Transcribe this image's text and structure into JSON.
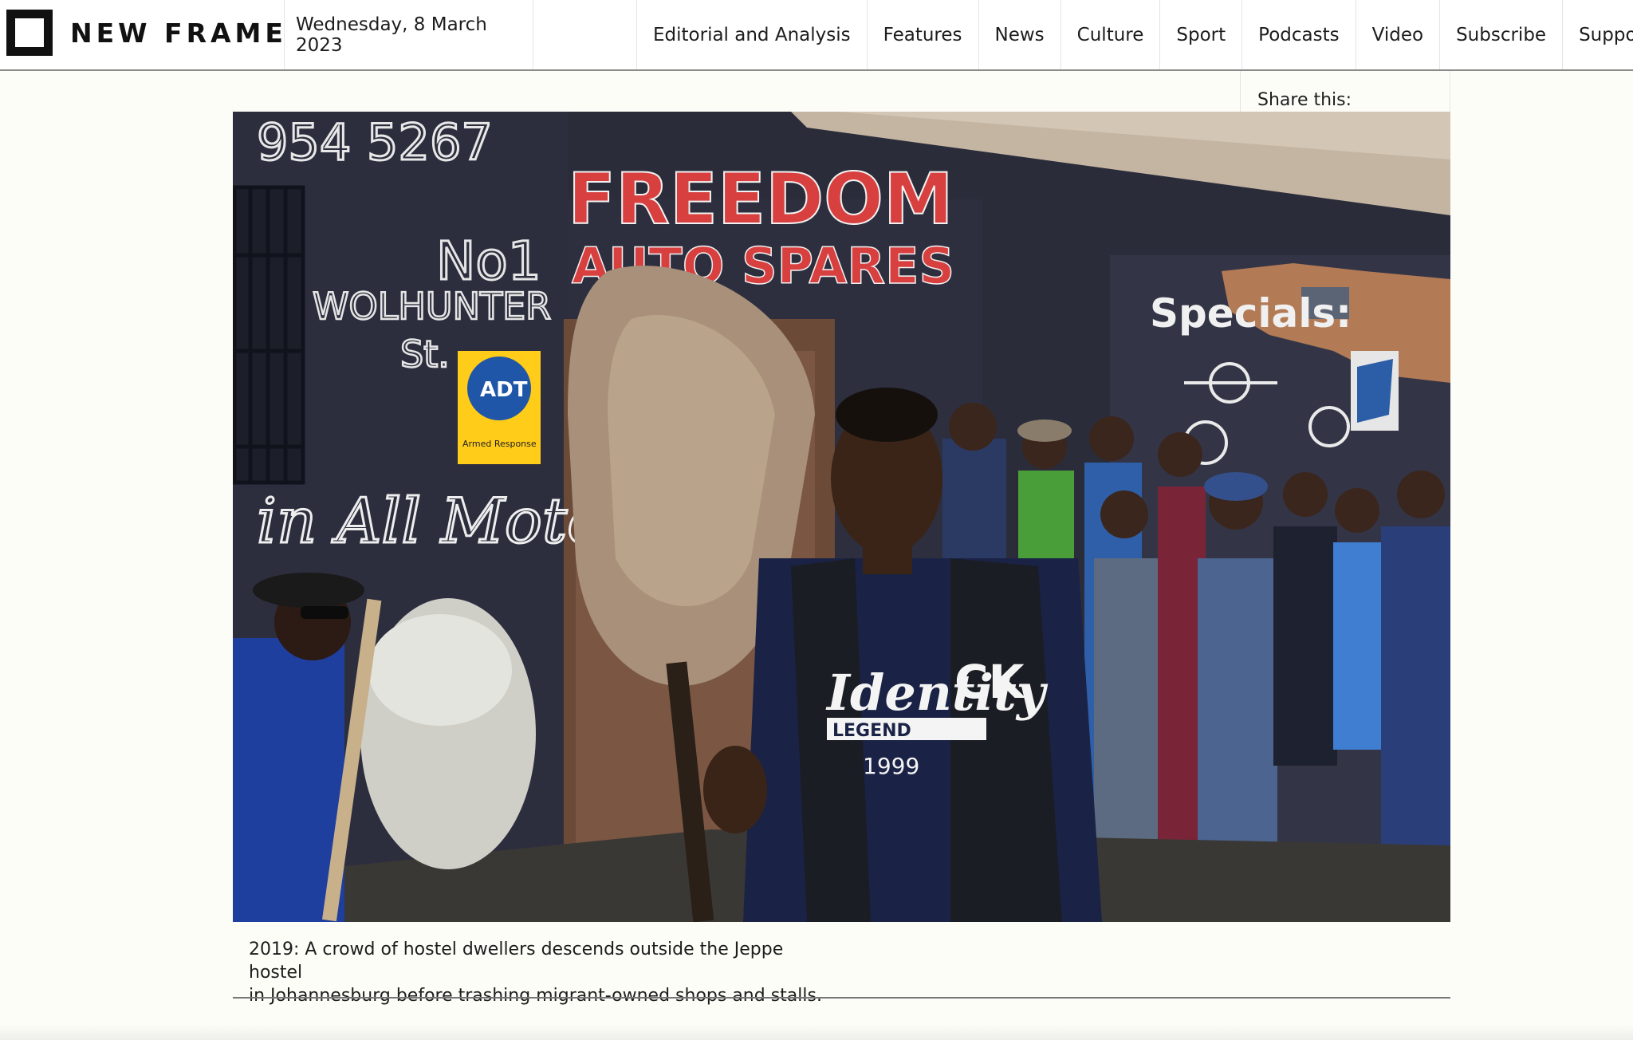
{
  "header": {
    "brand": "NEW FRAME",
    "date": "Wednesday, 8 March 2023",
    "nav": [
      "Editorial and Analysis",
      "Features",
      "News",
      "Culture",
      "Sport",
      "Podcasts",
      "Video",
      "Subscribe",
      "Support"
    ]
  },
  "share": {
    "label": "Share this:"
  },
  "photo": {
    "wall_text": {
      "phone": "954 5267",
      "freedom": "FREEDOM",
      "auto_spares": "AUTO SPARES",
      "number": "No1",
      "street": "WOLHUNTER",
      "st": "St.",
      "adt": "ADT",
      "adt_sub": "Armed Response",
      "specials": "Specials:",
      "motor": "in All Motor",
      "shirt_brand": "Identity",
      "shirt_sub": "LEGEND",
      "shirt_year": "1999",
      "vest": "CK"
    }
  },
  "caption": {
    "line1": "2019: A crowd of hostel dwellers descends outside the Jeppe hostel",
    "line2": "in Johannesburg before trashing migrant-owned shops and stalls."
  }
}
